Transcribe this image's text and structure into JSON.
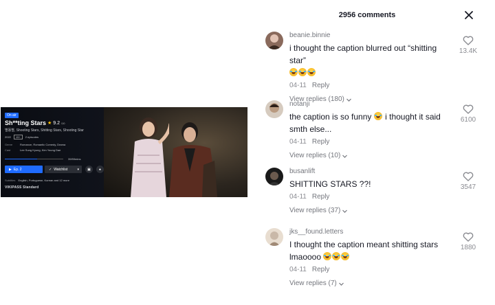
{
  "video": {
    "on_air_badge": "On air",
    "title": "Sh**ting Stars",
    "rating": "9.2",
    "rating_suffix": "/10",
    "alt_titles": "별똥별, Shooting Stars, Shitting Stars, Shooting Star",
    "year": "2022",
    "age_rating": "15+",
    "episodes": "2 episodes",
    "genre_label": "Genre",
    "genre_value": "Romance, Romantic Comedy, Drama",
    "cast_label": "Cast",
    "cast_value": "Lee Sung Kyung, Kim Young Dae",
    "progress_label": "39/59mins",
    "progress_fraction": 0.55,
    "play_button": "Ep. 2",
    "watchlist_button": "Watchlist",
    "subtitles_label": "Subtitles",
    "subtitles_value": "English, Portuguese, Korean and 12 more",
    "brand": "VIKIPASS Standard"
  },
  "comments_panel": {
    "header": "2956 comments",
    "comments": [
      {
        "username": "beanie.binnie",
        "text": "i thought the caption blurred out “shitting star”",
        "emoji_count": 3,
        "date": "04-11",
        "reply_label": "Reply",
        "view_replies": "View replies (180)",
        "likes": "13.4K",
        "avatar_color": "#8a6a5c"
      },
      {
        "username": "notanji",
        "text": "the caption is so funny",
        "text_after_emoji": "i thought it said smth else...",
        "emoji_count": 1,
        "date": "04-11",
        "reply_label": "Reply",
        "view_replies": "View replies (10)",
        "likes": "6100",
        "avatar_color": "#b99a80"
      },
      {
        "username": "busanlift",
        "text": "SHITTING STARS ??!",
        "emoji_count": 0,
        "date": "04-11",
        "reply_label": "Reply",
        "view_replies": "View replies (37)",
        "likes": "3547",
        "avatar_color": "#2a2a2a"
      },
      {
        "username": "jks__found.letters",
        "text": "I thought the caption meant shitting stars lmaoooo",
        "emoji_count": 3,
        "date": "04-11",
        "reply_label": "Reply",
        "view_replies": "View replies (7)",
        "likes": "1880",
        "avatar_color": "#c9b8a8"
      }
    ]
  },
  "icons": {
    "close": "close-icon",
    "heart": "heart-icon",
    "chevron": "chevron-down-icon"
  }
}
